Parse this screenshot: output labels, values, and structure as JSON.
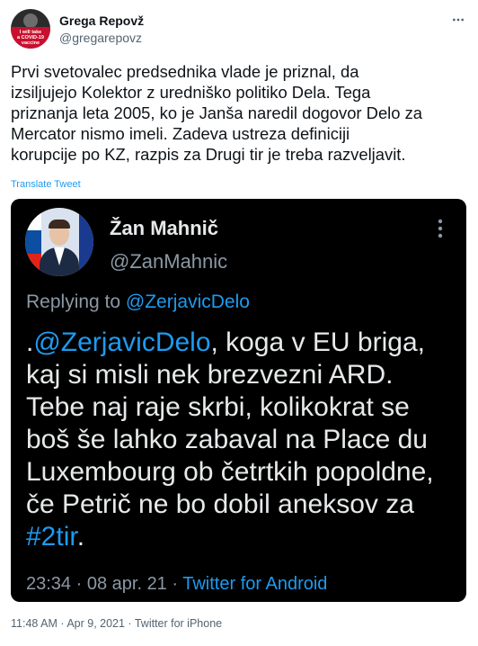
{
  "author": {
    "name": "Grega Repovž",
    "handle": "@gregarepovz",
    "avatar_text": [
      "I will take",
      "a COVID-19",
      "vaccine"
    ]
  },
  "more_icon": "more-horizontal-icon",
  "tweet_text": "Prvi svetovalec predsednika vlade je priznal, da\nizsiljujejo Kolektor z uredniško politiko Dela. Tega\npriznanja leta 2005, ko je Janša naredil dogovor Delo za\nMercator nismo imeli. Zadeva ustreza definiciji\nkorupcije po KZ, razpis za Drugi tir je treba razveljavit.",
  "translate_label": "Translate Tweet",
  "embedded": {
    "name": "Žan Mahnič",
    "handle": "@ZanMahnic",
    "replying_prefix": "Replying to ",
    "replying_to": "@ZerjavicDelo",
    "text_prefix": ".",
    "text_mention": "@ZerjavicDelo",
    "text_body": ", koga v EU briga, kaj si misli nek brezvezni ARD. Tebe naj raje skrbi, kolikokrat se boš še lahko zabaval na Place du Luxembourg ob četrtkih popoldne, če Petrič ne bo dobil aneksov za ",
    "hashtag": "#2tir",
    "text_suffix": ".",
    "time": "23:34",
    "date": "08 apr. 21",
    "source": "Twitter for Android",
    "separator": " · "
  },
  "meta": {
    "time": "11:48 AM",
    "date": "Apr 9, 2021",
    "source": "Twitter for iPhone",
    "separator": " · "
  },
  "colors": {
    "link": "#1d9bf0",
    "text": "#0f1419",
    "secondary": "#536471",
    "embed_bg": "#000000"
  }
}
